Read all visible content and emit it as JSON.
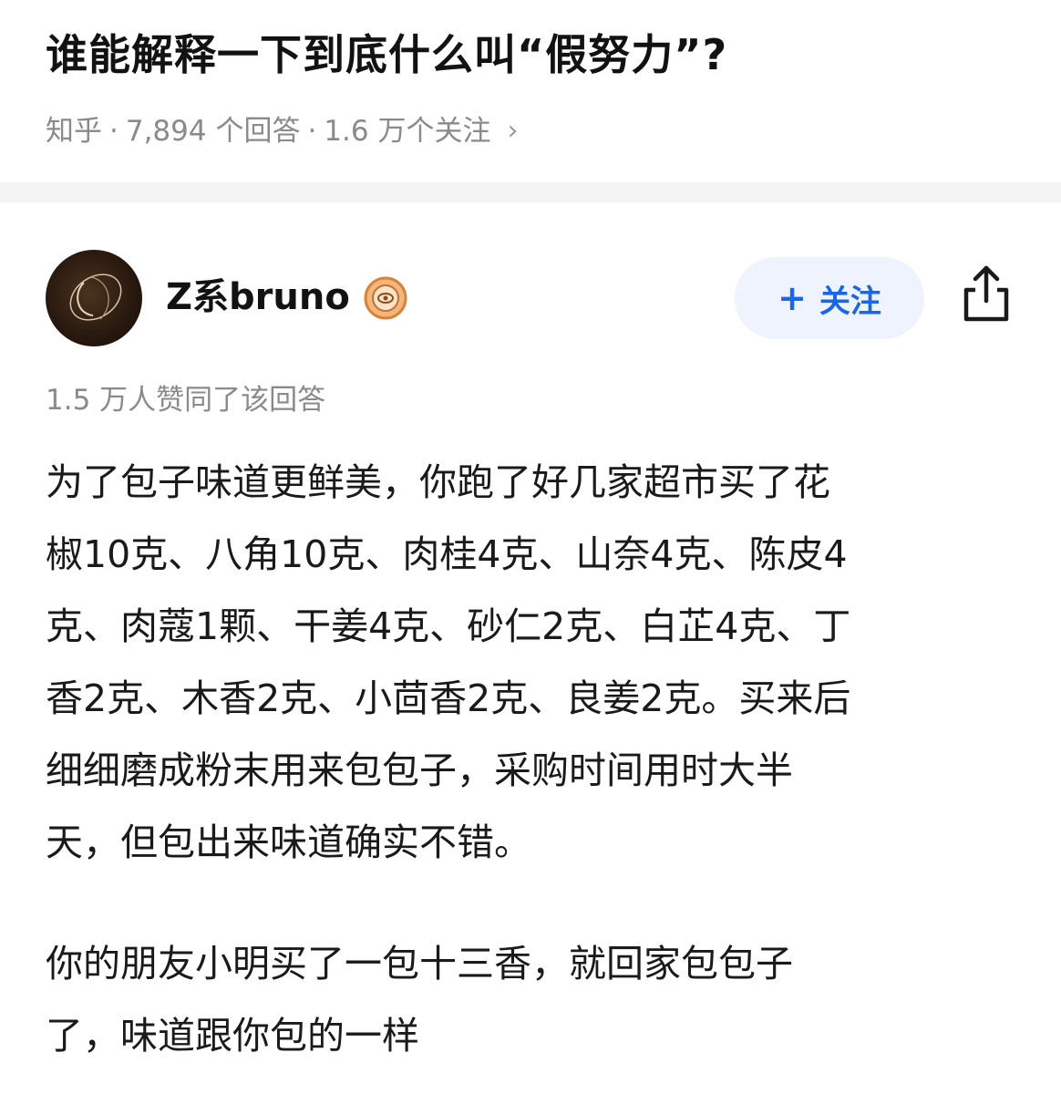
{
  "question": {
    "title": "谁能解释一下到底什么叫“假努力”?",
    "source": "知乎",
    "answer_count": "7,894 个回答",
    "follower_count": "1.6 万个关注",
    "separator": "·",
    "chevron": "›"
  },
  "author": {
    "name": "Z系bruno",
    "badge_icon": "certified-badge-icon",
    "follow_plus": "+",
    "follow_label": "关注",
    "share_icon": "share-icon"
  },
  "answer": {
    "upvotes": "1.5 万人赞同了该回答",
    "paragraph1_lines": [
      "为了包子味道更鲜美，你跑了好几家超市买了花",
      "椒10克、八角10克、肉桂4克、山奈4克、陈皮4",
      "克、肉蔻1颗、干姜4克、砂仁2克、白芷4克、丁",
      "香2克、木香2克、小茴香2克、良姜2克。买来后",
      "细细磨成粉末用来包包子，采购时间用时大半",
      "天，但包出来味道确实不错。"
    ],
    "paragraph2_lines": [
      "你的朋友小明买了一包十三香，就回家包包子",
      "了，味道跟你包的一样"
    ]
  },
  "colors": {
    "title": "#121212",
    "meta": "#8a8a8a",
    "accent": "#1a66e6",
    "follow_bg": "#eef3fd",
    "badge": "#e8944a"
  }
}
